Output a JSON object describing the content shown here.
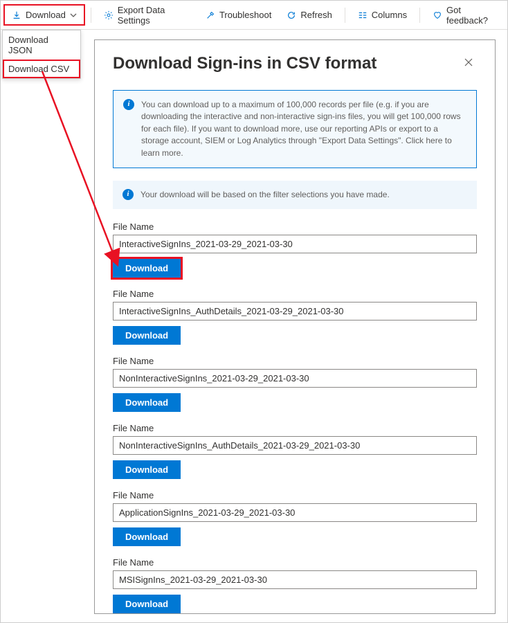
{
  "toolbar": {
    "download": "Download",
    "export": "Export Data Settings",
    "troubleshoot": "Troubleshoot",
    "refresh": "Refresh",
    "columns": "Columns",
    "feedback": "Got feedback?"
  },
  "dropdown": {
    "json": "Download JSON",
    "csv": "Download CSV"
  },
  "panel": {
    "title": "Download Sign-ins in CSV format",
    "banner1": "You can download up to a maximum of 100,000 records per file (e.g. if you are downloading the interactive and non-interactive sign-ins files, you will get 100,000 rows for each file).  If you want to download more, use our reporting APIs or export to a storage account, SIEM or Log Analytics through \"Export Data Settings\". Click here to learn more.",
    "banner2": "Your download will be based on the filter selections you have made.",
    "file_label": "File Name",
    "download_label": "Download",
    "files": [
      {
        "value": "InteractiveSignIns_2021-03-29_2021-03-30"
      },
      {
        "value": "InteractiveSignIns_AuthDetails_2021-03-29_2021-03-30"
      },
      {
        "value": "NonInteractiveSignIns_2021-03-29_2021-03-30"
      },
      {
        "value": "NonInteractiveSignIns_AuthDetails_2021-03-29_2021-03-30"
      },
      {
        "value": "ApplicationSignIns_2021-03-29_2021-03-30"
      },
      {
        "value": "MSISignIns_2021-03-29_2021-03-30"
      }
    ]
  }
}
